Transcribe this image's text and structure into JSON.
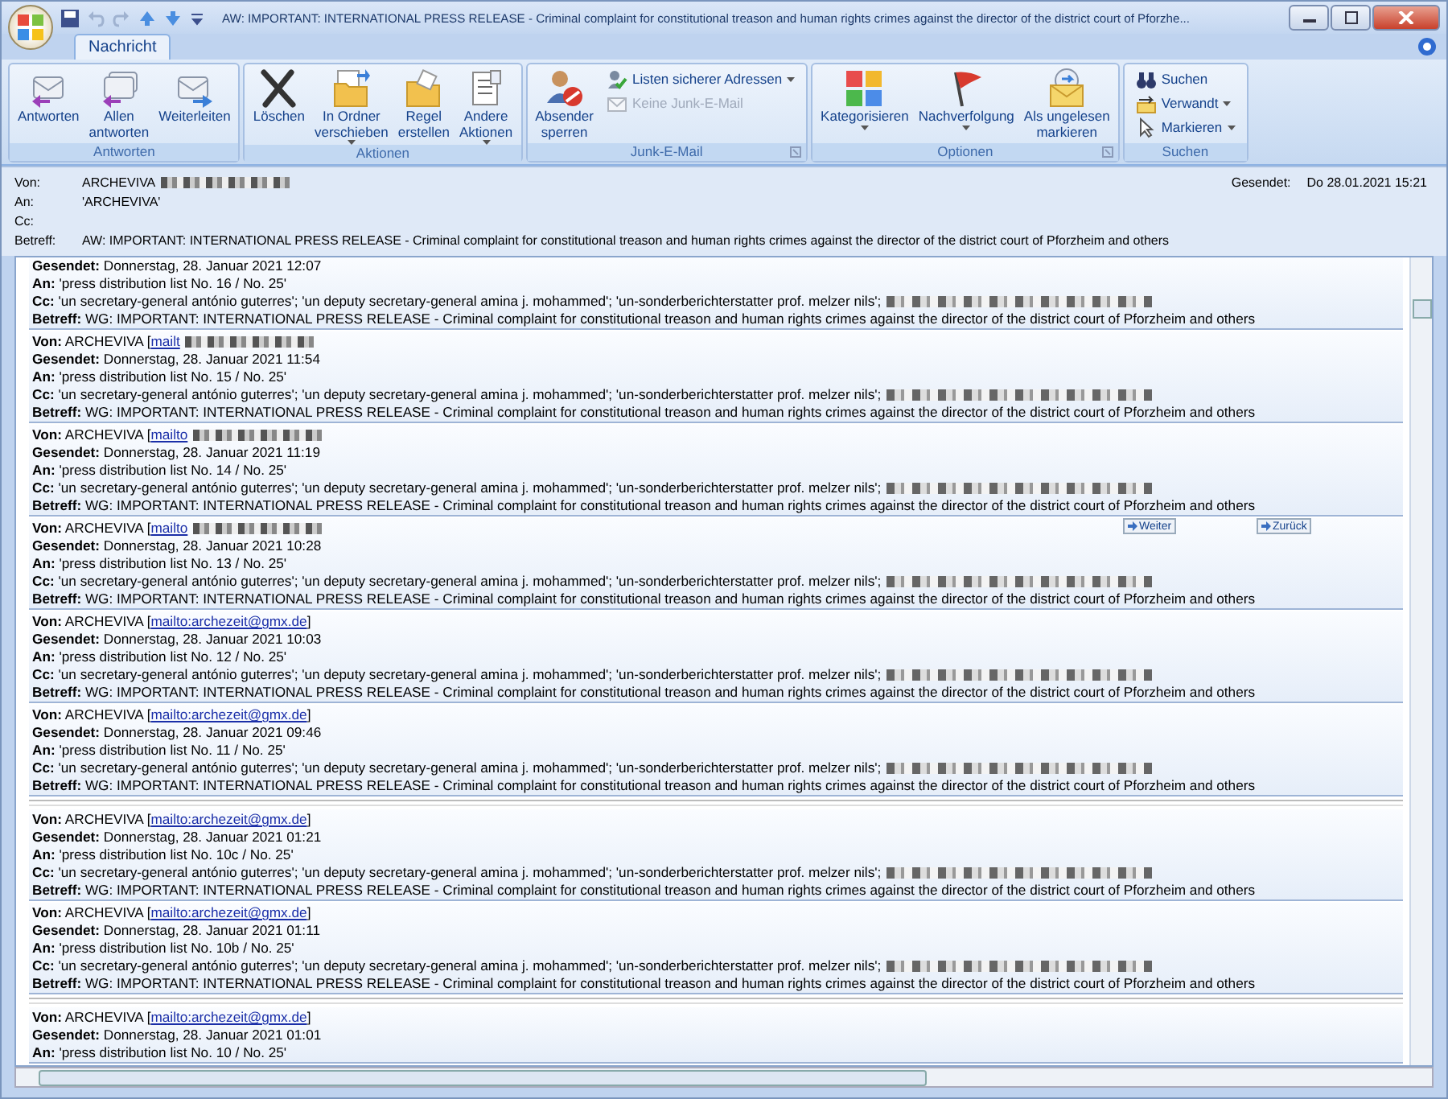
{
  "window": {
    "title": "AW: IMPORTANT:  INTERNATIONAL PRESS RELEASE  -  Criminal complaint for constitutional treason and human rights crimes against the director of the district court of Pforzhe..."
  },
  "tabs": [
    {
      "label": "Nachricht",
      "selected": true
    }
  ],
  "ribbon": [
    {
      "label": "Antworten",
      "launcher": false,
      "large": [
        {
          "label": "Antworten",
          "dropdown": false
        },
        {
          "label": "Allen\nantworten",
          "dropdown": false
        },
        {
          "label": "Weiterleiten",
          "dropdown": false
        }
      ]
    },
    {
      "label": "Aktionen",
      "launcher": false,
      "large": [
        {
          "label": "Löschen",
          "dropdown": false
        },
        {
          "label": "In Ordner\nverschieben",
          "dropdown": true
        },
        {
          "label": "Regel\nerstellen",
          "dropdown": false
        },
        {
          "label": "Andere\nAktionen",
          "dropdown": true
        }
      ]
    },
    {
      "label": "Junk-E-Mail",
      "launcher": true,
      "large": [
        {
          "label": "Absender\nsperren",
          "dropdown": false
        }
      ],
      "small": [
        {
          "label": "Listen sicherer Adressen",
          "dropdown": true,
          "disabled": false
        },
        {
          "label": "Keine Junk-E-Mail",
          "dropdown": false,
          "disabled": true
        }
      ]
    },
    {
      "label": "Optionen",
      "launcher": true,
      "large": [
        {
          "label": "Kategorisieren",
          "dropdown": true
        },
        {
          "label": "Nachverfolgung",
          "dropdown": true
        },
        {
          "label": "Als ungelesen\nmarkieren",
          "dropdown": false
        }
      ]
    },
    {
      "label": "Suchen",
      "launcher": false,
      "small": [
        {
          "label": "Suchen",
          "dropdown": false,
          "disabled": false
        },
        {
          "label": "Verwandt",
          "dropdown": true,
          "disabled": false
        },
        {
          "label": "Markieren",
          "dropdown": true,
          "disabled": false
        }
      ]
    }
  ],
  "header": {
    "von_label": "Von:",
    "von": "ARCHEVIVA",
    "von_redacted": true,
    "an_label": "An:",
    "an": "'ARCHEVIVA'",
    "cc_label": "Cc:",
    "betreff_label": "Betreff:",
    "betreff": "AW: IMPORTANT:  INTERNATIONAL PRESS RELEASE  -  Criminal complaint for constitutional treason and human rights crimes against the director of the district court of Pforzheim and others",
    "gesendet_label": "Gesendet:",
    "gesendet": "Do 28.01.2021 15:21"
  },
  "messages": [
    {
      "kind": "message",
      "lines": [
        {
          "label": "Gesendet:",
          "text": "Donnerstag, 28. Januar 2021 12:07"
        },
        {
          "label": "An:",
          "text": "'press distribution list No. 16 / No. 25'"
        },
        {
          "label": "Cc:",
          "text": "'un secretary-general antónio guterres'; 'un deputy secretary-general amina j. mohammed'; 'un-sonderberichterstatter prof. melzer nils';",
          "redacted": true
        },
        {
          "label": "Betreff:",
          "text": "WG: IMPORTANT: INTERNATIONAL PRESS RELEASE - Criminal complaint for constitutional treason and human rights crimes against the director of the district court of Pforzheim and others"
        }
      ]
    },
    {
      "kind": "message",
      "lines": [
        {
          "label": "Von:",
          "text": "ARCHEVIVA [",
          "link": "mailt",
          "redacted": true
        },
        {
          "label": "Gesendet:",
          "text": "Donnerstag, 28. Januar 2021 11:54"
        },
        {
          "label": "An:",
          "text": "'press distribution list No. 15 / No. 25'"
        },
        {
          "label": "Cc:",
          "text": "'un secretary-general antónio guterres'; 'un deputy secretary-general amina j. mohammed'; 'un-sonderberichterstatter prof. melzer nils';",
          "redacted": true
        },
        {
          "label": "Betreff:",
          "text": "WG: IMPORTANT: INTERNATIONAL PRESS RELEASE - Criminal complaint for constitutional treason and human rights crimes against the director of the district court of Pforzheim and others"
        }
      ]
    },
    {
      "kind": "message",
      "lines": [
        {
          "label": "Von:",
          "text": "ARCHEVIVA [",
          "link": "mailto",
          "redacted": true
        },
        {
          "label": "Gesendet:",
          "text": "Donnerstag, 28. Januar 2021 11:19"
        },
        {
          "label": "An:",
          "text": "'press distribution list No. 14 / No. 25'"
        },
        {
          "label": "Cc:",
          "text": "'un secretary-general antónio guterres'; 'un deputy secretary-general amina j. mohammed'; 'un-sonderberichterstatter prof. melzer nils';",
          "redacted": true
        },
        {
          "label": "Betreff:",
          "text": "WG: IMPORTANT: INTERNATIONAL PRESS RELEASE - Criminal complaint for constitutional treason and human rights crimes against the director of the district court of Pforzheim and others"
        }
      ]
    },
    {
      "kind": "message",
      "nav": [
        {
          "label": "Weiter"
        },
        {
          "label": "Zurück"
        }
      ],
      "lines": [
        {
          "label": "Von:",
          "text": "ARCHEVIVA [",
          "link": "mailto",
          "redacted": true
        },
        {
          "label": "Gesendet:",
          "text": "Donnerstag, 28. Januar 2021 10:28"
        },
        {
          "label": "An:",
          "text": "'press distribution list No. 13 / No. 25'"
        },
        {
          "label": "Cc:",
          "text": "'un secretary-general antónio guterres'; 'un deputy secretary-general amina j. mohammed'; 'un-sonderberichterstatter prof. melzer nils';",
          "redacted": true
        },
        {
          "label": "Betreff:",
          "text": "WG: IMPORTANT: INTERNATIONAL PRESS RELEASE - Criminal complaint for constitutional treason and human rights crimes against the director of the district court of Pforzheim and others"
        }
      ]
    },
    {
      "kind": "message",
      "lines": [
        {
          "label": "Von:",
          "text": "ARCHEVIVA [",
          "link": "mailto:archezeit@gmx.de",
          "end": "]",
          "redacted": false
        },
        {
          "label": "Gesendet:",
          "text": "Donnerstag, 28. Januar 2021 10:03"
        },
        {
          "label": "An:",
          "text": "'press distribution list No. 12 / No. 25'"
        },
        {
          "label": "Cc:",
          "text": "'un secretary-general antónio guterres'; 'un deputy secretary-general amina j. mohammed'; 'un-sonderberichterstatter prof. melzer nils';",
          "redacted": true
        },
        {
          "label": "Betreff:",
          "text": "WG: IMPORTANT: INTERNATIONAL PRESS RELEASE - Criminal complaint for constitutional treason and human rights crimes against the director of the district court of Pforzheim and others"
        }
      ]
    },
    {
      "kind": "message",
      "lines": [
        {
          "label": "Von:",
          "text": "ARCHEVIVA [",
          "link": "mailto:archezeit@gmx.de",
          "end": "]",
          "redacted": false
        },
        {
          "label": "Gesendet:",
          "text": "Donnerstag, 28. Januar 2021 09:46"
        },
        {
          "label": "An:",
          "text": "'press distribution list No. 11 / No. 25'"
        },
        {
          "label": "Cc:",
          "text": "'un secretary-general antónio guterres'; 'un deputy secretary-general amina j. mohammed'; 'un-sonderberichterstatter prof. melzer nils';",
          "redacted": true
        },
        {
          "label": "Betreff:",
          "text": "WG: IMPORTANT: INTERNATIONAL PRESS RELEASE - Criminal complaint for constitutional treason and human rights crimes against the director of the district court of Pforzheim and others"
        }
      ]
    },
    {
      "kind": "separator"
    },
    {
      "kind": "message",
      "lines": [
        {
          "label": "Von:",
          "text": "ARCHEVIVA [",
          "link": "mailto:archezeit@gmx.de",
          "end": "]",
          "redacted": false
        },
        {
          "label": "Gesendet:",
          "text": "Donnerstag, 28. Januar 2021 01:21"
        },
        {
          "label": "An:",
          "text": "'press distribution list No. 10c / No. 25'"
        },
        {
          "label": "Cc:",
          "text": "'un secretary-general antónio guterres'; 'un deputy secretary-general amina j. mohammed'; 'un-sonderberichterstatter prof. melzer nils';",
          "redacted": true
        },
        {
          "label": "Betreff:",
          "text": "WG: IMPORTANT: INTERNATIONAL PRESS RELEASE - Criminal complaint for constitutional treason and human rights crimes against the director of the district court of Pforzheim and others"
        }
      ]
    },
    {
      "kind": "message",
      "lines": [
        {
          "label": "Von:",
          "text": "ARCHEVIVA [",
          "link": "mailto:archezeit@gmx.de",
          "end": "]",
          "redacted": false
        },
        {
          "label": "Gesendet:",
          "text": "Donnerstag, 28. Januar 2021 01:11"
        },
        {
          "label": "An:",
          "text": "'press distribution list No. 10b / No. 25'"
        },
        {
          "label": "Cc:",
          "text": "'un secretary-general antónio guterres'; 'un deputy secretary-general amina j. mohammed'; 'un-sonderberichterstatter prof. melzer nils';",
          "redacted": true
        },
        {
          "label": "Betreff:",
          "text": "WG: IMPORTANT: INTERNATIONAL PRESS RELEASE - Criminal complaint for constitutional treason and human rights crimes against the director of the district court of Pforzheim and others"
        }
      ]
    },
    {
      "kind": "separator"
    },
    {
      "kind": "message",
      "lines": [
        {
          "label": "Von:",
          "text": "ARCHEVIVA [",
          "link": "mailto:archezeit@gmx.de",
          "end": "]",
          "redacted": false
        },
        {
          "label": "Gesendet:",
          "text": "Donnerstag, 28. Januar 2021 01:01"
        },
        {
          "label": "An:",
          "text": "'press distribution list No. 10 / No. 25'"
        }
      ]
    }
  ]
}
